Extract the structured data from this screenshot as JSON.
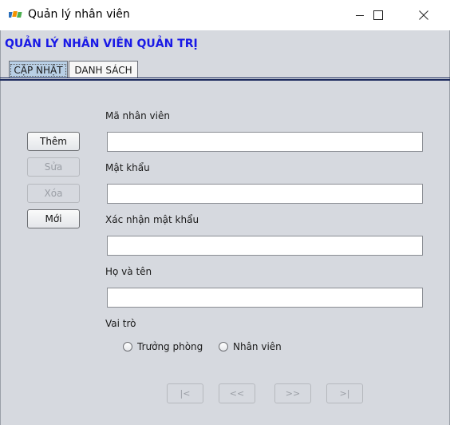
{
  "window": {
    "title": "Quản lý nhân viên"
  },
  "header": {
    "title": "QUẢN LÝ NHÂN VIÊN QUẢN TRỊ",
    "title_color": "#1919e6"
  },
  "tabs": [
    {
      "label": "CẬP NHẬT",
      "active": true
    },
    {
      "label": "DANH SÁCH",
      "active": false
    }
  ],
  "actions": {
    "add": {
      "label": "Thêm",
      "enabled": true
    },
    "edit": {
      "label": "Sửa",
      "enabled": false
    },
    "delete": {
      "label": "Xóa",
      "enabled": false
    },
    "new": {
      "label": "Mới",
      "enabled": true
    }
  },
  "form": {
    "employee_id": {
      "label": "Mã nhân viên",
      "value": ""
    },
    "password": {
      "label": "Mật khẩu",
      "value": ""
    },
    "confirm_password": {
      "label": "Xác nhận mật khẩu",
      "value": ""
    },
    "full_name": {
      "label": "Họ và tên",
      "value": ""
    },
    "role": {
      "label": "Vai trò",
      "options": [
        {
          "label": "Trưởng phòng",
          "selected": false
        },
        {
          "label": "Nhân viên",
          "selected": false
        }
      ]
    }
  },
  "navigation": {
    "first": "|<",
    "prev": "<<",
    "next": ">>",
    "last": ">|"
  },
  "icons": {
    "app": "fpt-logo-icon",
    "minimize": "minimize-icon",
    "maximize": "maximize-icon",
    "close": "close-icon"
  }
}
